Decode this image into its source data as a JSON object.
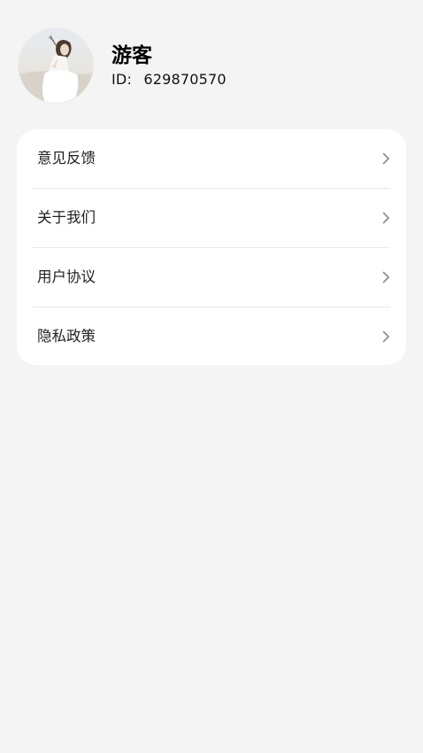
{
  "profile": {
    "name": "游客",
    "id_label": "ID:",
    "id_value": "629870570"
  },
  "menu": {
    "items": [
      {
        "label": "意见反馈",
        "icon": "chevron-right-icon"
      },
      {
        "label": "关于我们",
        "icon": "chevron-right-icon"
      },
      {
        "label": "用户协议",
        "icon": "chevron-right-icon"
      },
      {
        "label": "隐私政策",
        "icon": "chevron-right-icon"
      }
    ]
  },
  "colors": {
    "background": "#f4f4f4",
    "card": "#ffffff",
    "divider": "#e9e9e9",
    "chevron": "#8a8a8a",
    "text_primary": "#000000"
  }
}
